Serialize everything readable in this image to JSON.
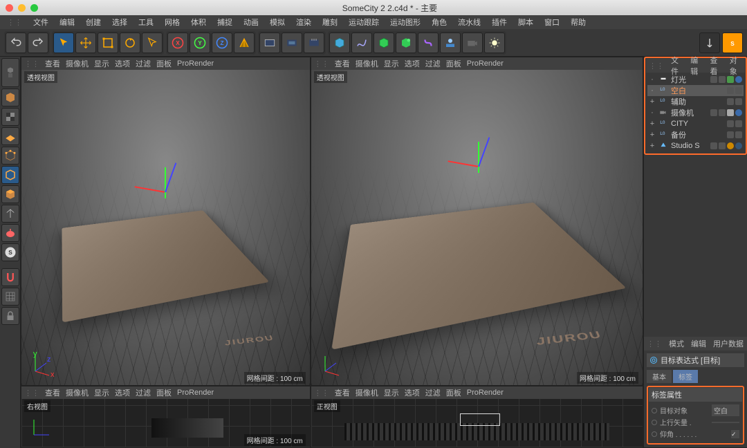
{
  "window": {
    "title": "SomeCity 2 2.c4d * - 主要"
  },
  "menubar": [
    "文件",
    "编辑",
    "创建",
    "选择",
    "工具",
    "网格",
    "体积",
    "捕捉",
    "动画",
    "模拟",
    "渲染",
    "雕刻",
    "运动跟踪",
    "运动图形",
    "角色",
    "流水线",
    "插件",
    "脚本",
    "窗口",
    "帮助"
  ],
  "viewport_menu": [
    "查看",
    "摄像机",
    "显示",
    "选项",
    "过滤",
    "面板",
    "ProRender"
  ],
  "viewport": {
    "persp_label": "透视视图",
    "right_label": "右视图",
    "front_label": "正视图",
    "grid_info": "网格间距 : 100 cm",
    "logo_text": "JIUROU"
  },
  "obj_panel": {
    "tabs": [
      "文件",
      "编辑",
      "查看",
      "对象"
    ],
    "items": [
      {
        "name": "灯光",
        "icon": "light",
        "sel": false
      },
      {
        "name": "空白",
        "icon": "null",
        "sel": true
      },
      {
        "name": "辅助",
        "icon": "null",
        "sel": false,
        "exp": "+"
      },
      {
        "name": "摄像机",
        "icon": "camera",
        "sel": false
      },
      {
        "name": "CITY",
        "icon": "null",
        "sel": false,
        "exp": "+"
      },
      {
        "name": "备份",
        "icon": "null",
        "sel": false,
        "exp": "+"
      },
      {
        "name": "Studio S",
        "icon": "scene",
        "sel": false,
        "exp": "+"
      }
    ]
  },
  "attr_panel": {
    "tabs": [
      "模式",
      "编辑",
      "用户数据"
    ],
    "title": "目标表达式 [目标]",
    "subtabs": [
      {
        "label": "基本",
        "active": false
      },
      {
        "label": "标签",
        "active": true
      }
    ],
    "group_title": "标签属性",
    "rows": [
      {
        "label": "目标对象",
        "value": "空白",
        "type": "link"
      },
      {
        "label": "上行矢量 .",
        "value": "",
        "type": "link"
      },
      {
        "label": "仰角 . . . . . .",
        "value": "",
        "type": "check",
        "checked": true
      }
    ]
  }
}
